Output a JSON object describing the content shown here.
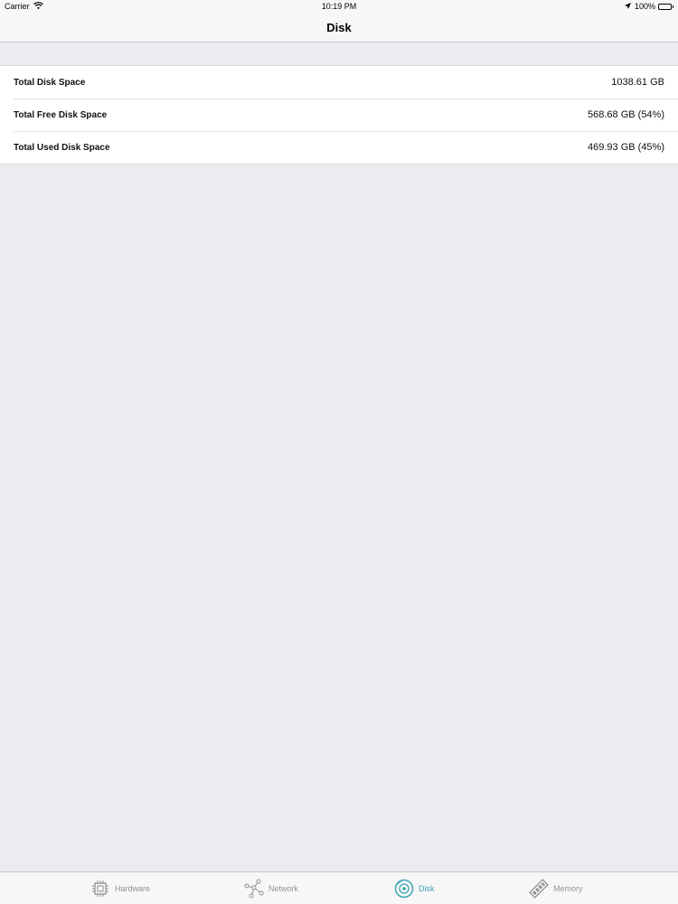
{
  "status_bar": {
    "carrier": "Carrier",
    "time": "10:19 PM",
    "battery": "100%"
  },
  "nav": {
    "title": "Disk"
  },
  "rows": [
    {
      "label": "Total Disk Space",
      "value": "1038.61 GB"
    },
    {
      "label": "Total Free Disk Space",
      "value": "568.68 GB (54%)"
    },
    {
      "label": "Total Used Disk Space",
      "value": "469.93 GB (45%)"
    }
  ],
  "tabs": [
    {
      "label": "Hardware",
      "icon": "chip-icon"
    },
    {
      "label": "Network",
      "icon": "network-icon"
    },
    {
      "label": "Disk",
      "icon": "disk-icon",
      "active": true
    },
    {
      "label": "Memory",
      "icon": "memory-icon"
    }
  ],
  "colors": {
    "accent": "#3aa4b4",
    "inactive": "#929292",
    "background": "#ebebf0"
  }
}
